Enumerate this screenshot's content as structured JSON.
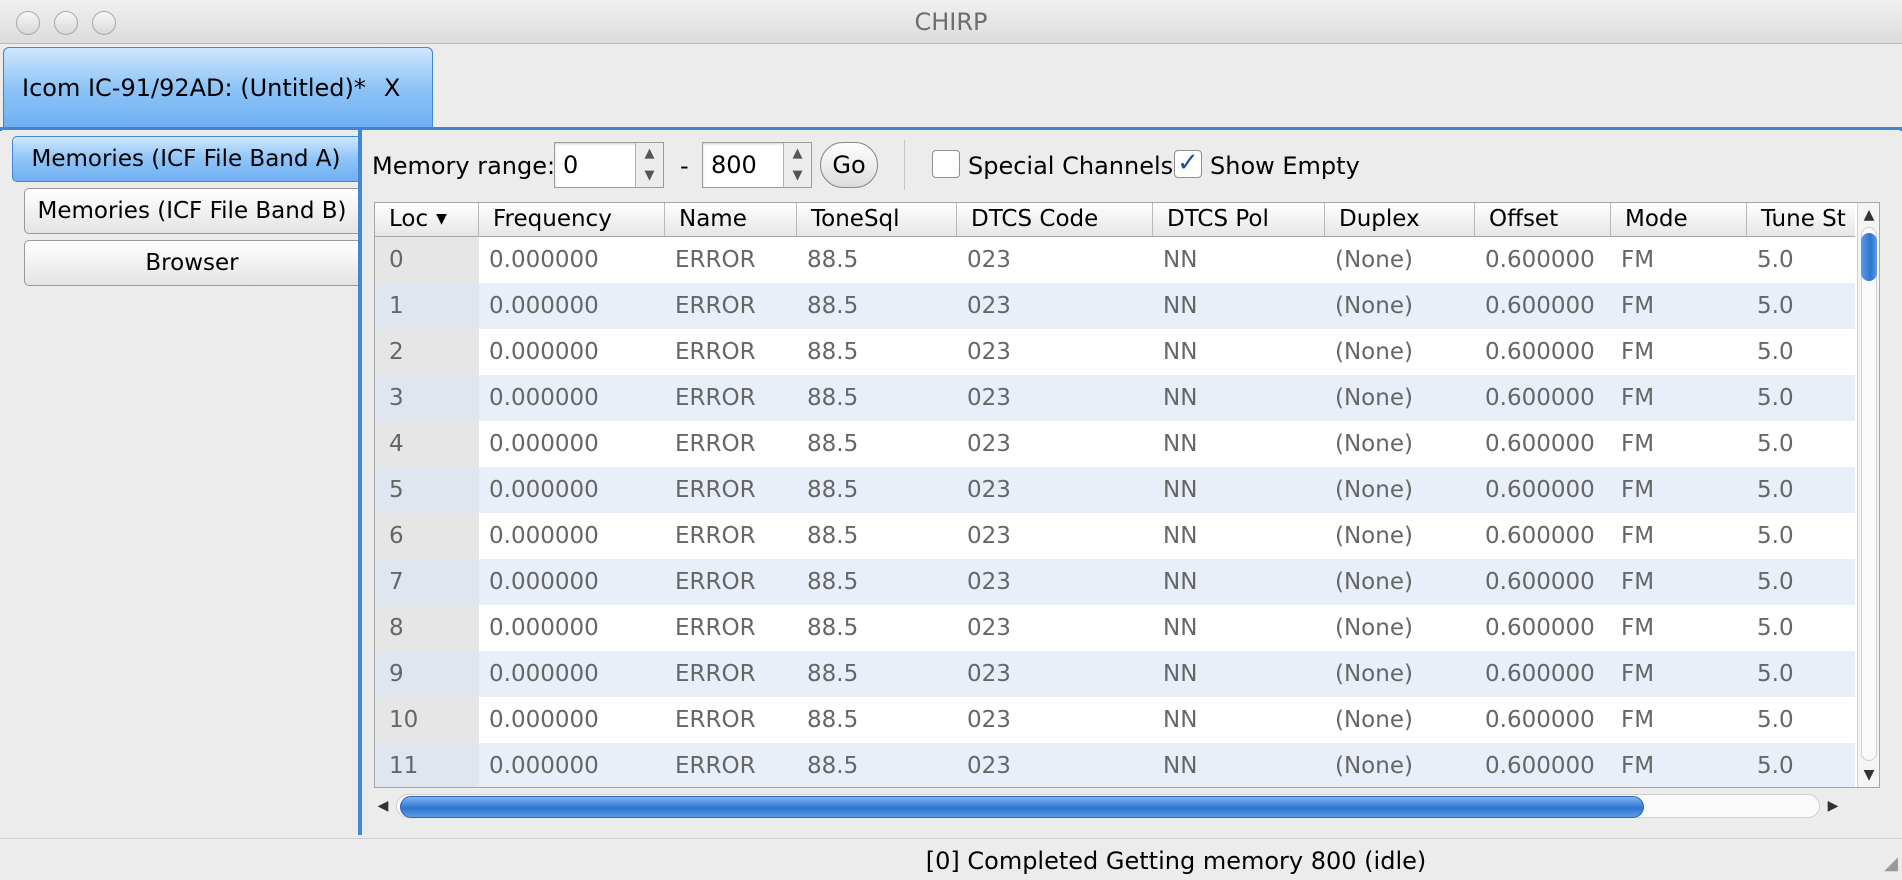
{
  "window": {
    "title": "CHIRP"
  },
  "doc_tab": {
    "label": "Icom IC-91/92AD: (Untitled)*",
    "close_label": "X"
  },
  "sidebar": {
    "tabs": [
      {
        "label": "Memories (ICF File Band A)",
        "active": true
      },
      {
        "label": "Memories (ICF File Band B)",
        "active": false
      },
      {
        "label": "Browser",
        "active": false
      }
    ]
  },
  "toolbar": {
    "range_label": "Memory range:",
    "range_start": "0",
    "range_dash": "-",
    "range_end": "800",
    "go_label": "Go",
    "special_label": "Special Channels",
    "special_checked": false,
    "show_empty_label": "Show Empty",
    "show_empty_checked": true
  },
  "table": {
    "columns": [
      "Loc",
      "Frequency",
      "Name",
      "ToneSql",
      "DTCS Code",
      "DTCS Pol",
      "Duplex",
      "Offset",
      "Mode",
      "Tune St"
    ],
    "sort_column": "Loc",
    "rows": [
      [
        "0",
        "0.000000",
        "ERROR",
        "88.5",
        "023",
        "NN",
        "(None)",
        "0.600000",
        "FM",
        "5.0"
      ],
      [
        "1",
        "0.000000",
        "ERROR",
        "88.5",
        "023",
        "NN",
        "(None)",
        "0.600000",
        "FM",
        "5.0"
      ],
      [
        "2",
        "0.000000",
        "ERROR",
        "88.5",
        "023",
        "NN",
        "(None)",
        "0.600000",
        "FM",
        "5.0"
      ],
      [
        "3",
        "0.000000",
        "ERROR",
        "88.5",
        "023",
        "NN",
        "(None)",
        "0.600000",
        "FM",
        "5.0"
      ],
      [
        "4",
        "0.000000",
        "ERROR",
        "88.5",
        "023",
        "NN",
        "(None)",
        "0.600000",
        "FM",
        "5.0"
      ],
      [
        "5",
        "0.000000",
        "ERROR",
        "88.5",
        "023",
        "NN",
        "(None)",
        "0.600000",
        "FM",
        "5.0"
      ],
      [
        "6",
        "0.000000",
        "ERROR",
        "88.5",
        "023",
        "NN",
        "(None)",
        "0.600000",
        "FM",
        "5.0"
      ],
      [
        "7",
        "0.000000",
        "ERROR",
        "88.5",
        "023",
        "NN",
        "(None)",
        "0.600000",
        "FM",
        "5.0"
      ],
      [
        "8",
        "0.000000",
        "ERROR",
        "88.5",
        "023",
        "NN",
        "(None)",
        "0.600000",
        "FM",
        "5.0"
      ],
      [
        "9",
        "0.000000",
        "ERROR",
        "88.5",
        "023",
        "NN",
        "(None)",
        "0.600000",
        "FM",
        "5.0"
      ],
      [
        "10",
        "0.000000",
        "ERROR",
        "88.5",
        "023",
        "NN",
        "(None)",
        "0.600000",
        "FM",
        "5.0"
      ],
      [
        "11",
        "0.000000",
        "ERROR",
        "88.5",
        "023",
        "NN",
        "(None)",
        "0.600000",
        "FM",
        "5.0"
      ]
    ]
  },
  "status": {
    "text": "[0] Completed Getting memory 800 (idle)"
  },
  "icons": {
    "sort": "sort-descending-icon",
    "checkmark": "checkmark-icon"
  },
  "colors": {
    "accent": "#3f87d6",
    "row_alt": "#e8eff8",
    "scroll_thumb": "#2f74cf"
  }
}
